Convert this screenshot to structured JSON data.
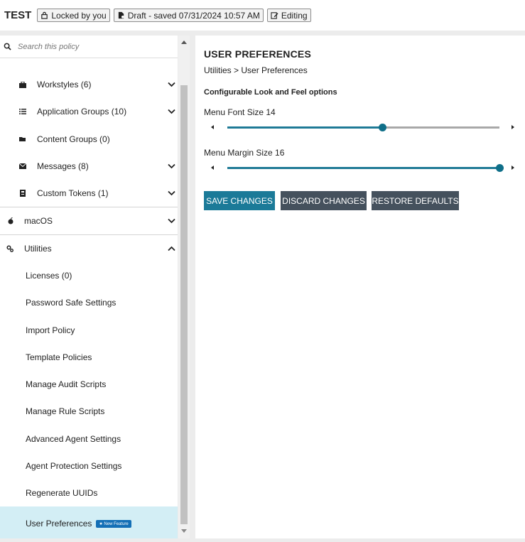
{
  "header": {
    "policy_name": "TEST",
    "lock_label": "Locked by you",
    "draft_label": "Draft - saved 07/31/2024 10:57 AM",
    "editing_label": "Editing"
  },
  "sidebar": {
    "search_placeholder": "Search this policy",
    "items": [
      {
        "label": "Workstyles (6)",
        "icon": "briefcase-icon",
        "expandable": true
      },
      {
        "label": "Application Groups (10)",
        "icon": "list-icon",
        "expandable": true
      },
      {
        "label": "Content Groups (0)",
        "icon": "folder-icon",
        "expandable": false
      },
      {
        "label": "Messages (8)",
        "icon": "envelope-icon",
        "expandable": true
      },
      {
        "label": "Custom Tokens (1)",
        "icon": "token-icon",
        "expandable": true
      }
    ],
    "macos_label": "macOS",
    "utilities_label": "Utilities",
    "utilities_items": [
      "Licenses (0)",
      "Password Safe Settings",
      "Import Policy",
      "Template Policies",
      "Manage Audit Scripts",
      "Manage Rule Scripts",
      "Advanced Agent Settings",
      "Agent Protection Settings",
      "Regenerate UUIDs",
      "User Preferences"
    ],
    "new_feature_badge": "★ New Feature"
  },
  "main": {
    "title": "USER PREFERENCES",
    "breadcrumb": "Utilities > User Preferences",
    "section_title": "Configurable Look and Feel options",
    "font_size_label": "Menu Font Size 14",
    "font_size_level": 0.57,
    "margin_size_label": "Menu Margin Size 16",
    "margin_size_level": 1.0,
    "save_label": "SAVE CHANGES",
    "discard_label": "DISCARD CHANGES",
    "restore_label": "RESTORE DEFAULTS"
  },
  "colors": {
    "accent": "#1b7a98",
    "dark_button": "#45515d",
    "selected_bg": "#d3eef5",
    "badge": "#136fb6"
  }
}
